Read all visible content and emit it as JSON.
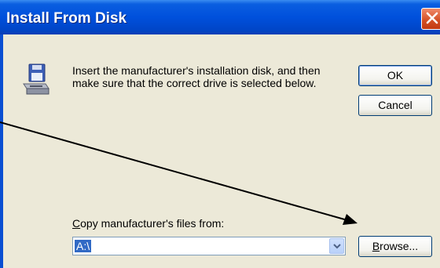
{
  "dialog": {
    "title": "Install From Disk",
    "message_line1": "Insert the manufacturer's installation disk, and then",
    "message_line2": "make sure that the correct drive is selected below."
  },
  "buttons": {
    "ok_label": "OK",
    "cancel_label": "Cancel",
    "browse_label_accesskey": "B",
    "browse_label_rest": "rowse..."
  },
  "copy_from": {
    "label_accesskey": "C",
    "label_rest": "opy manufacturer's files from:",
    "value": "A:\\"
  },
  "icons": {
    "disk": "floppy-drive-icon",
    "close": "close-icon",
    "dropdown": "chevron-down-icon"
  },
  "colors": {
    "title_bar": "#0050dc",
    "dialog_bg": "#ece9d8",
    "close_button": "#d24d22",
    "selection": "#316ac5",
    "annotation_arrow": "#000000"
  }
}
